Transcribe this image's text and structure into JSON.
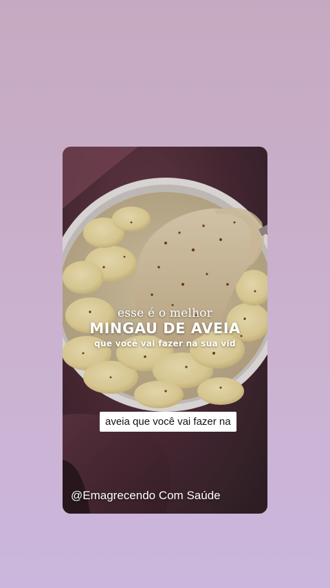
{
  "post": {
    "text_line_1": "esse é o melhor",
    "text_line_2": "MINGAU DE AVEIA",
    "text_line_3": "que você vai fazer na sua vid",
    "caption": "aveia que você vai fazer na",
    "username": "@Emagrecendo Com Saúde"
  },
  "colors": {
    "background_top": "#c6a9c1",
    "background_bottom": "#cbb6dd",
    "card_background": "#4b2a36",
    "caption_background": "#ffffff"
  }
}
